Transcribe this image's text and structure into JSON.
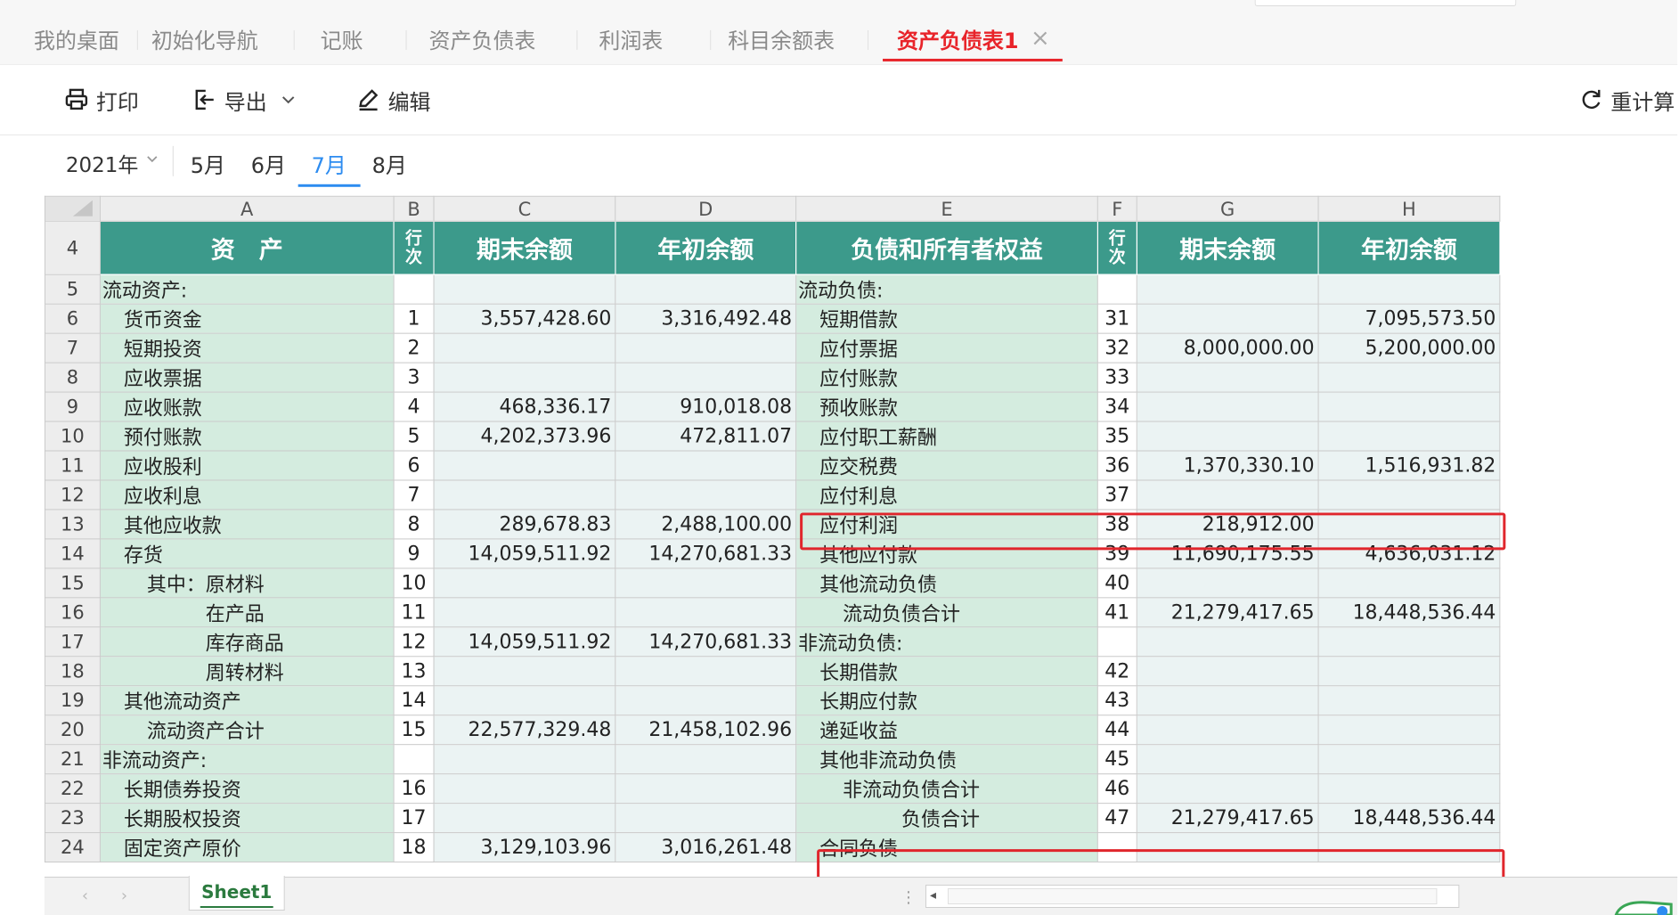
{
  "tabs": [
    {
      "label": "我的桌面"
    },
    {
      "label": "初始化导航"
    },
    {
      "label": "记账"
    },
    {
      "label": "资产负债表"
    },
    {
      "label": "利润表"
    },
    {
      "label": "科目余额表"
    },
    {
      "label": "资产负债表1",
      "active": true
    }
  ],
  "toolbar": {
    "print_label": "打印",
    "export_label": "导出",
    "edit_label": "编辑",
    "recalc_label": "重计算"
  },
  "period": {
    "year": "2021年",
    "months": [
      "5月",
      "6月",
      "7月",
      "8月"
    ],
    "active_month": "7月"
  },
  "grid": {
    "col_letters": [
      "A",
      "B",
      "C",
      "D",
      "E",
      "F",
      "G",
      "H"
    ],
    "header_row_num": "4",
    "headers": {
      "assets": "资　产",
      "line_a": "行次",
      "end_a": "期末余额",
      "begin_a": "年初余额",
      "liab": "负债和所有者权益",
      "line_b": "行次",
      "end_b": "期末余额",
      "begin_b": "年初余额"
    },
    "rows": [
      {
        "r": "5",
        "a": "流动资产:",
        "ai": 0,
        "b": "",
        "c": "",
        "d": "",
        "e": "流动负债:",
        "ei": 0,
        "f": "",
        "g": "",
        "h": ""
      },
      {
        "r": "6",
        "a": "货币资金",
        "ai": 1,
        "b": "1",
        "c": "3,557,428.60",
        "d": "3,316,492.48",
        "e": "短期借款",
        "ei": 1,
        "f": "31",
        "g": "",
        "h": "7,095,573.50"
      },
      {
        "r": "7",
        "a": "短期投资",
        "ai": 1,
        "b": "2",
        "c": "",
        "d": "",
        "e": "应付票据",
        "ei": 1,
        "f": "32",
        "g": "8,000,000.00",
        "h": "5,200,000.00"
      },
      {
        "r": "8",
        "a": "应收票据",
        "ai": 1,
        "b": "3",
        "c": "",
        "d": "",
        "e": "应付账款",
        "ei": 1,
        "f": "33",
        "g": "",
        "h": ""
      },
      {
        "r": "9",
        "a": "应收账款",
        "ai": 1,
        "b": "4",
        "c": "468,336.17",
        "d": "910,018.08",
        "e": "预收账款",
        "ei": 1,
        "f": "34",
        "g": "",
        "h": ""
      },
      {
        "r": "10",
        "a": "预付账款",
        "ai": 1,
        "b": "5",
        "c": "4,202,373.96",
        "d": "472,811.07",
        "e": "应付职工薪酬",
        "ei": 1,
        "f": "35",
        "g": "",
        "h": ""
      },
      {
        "r": "11",
        "a": "应收股利",
        "ai": 1,
        "b": "6",
        "c": "",
        "d": "",
        "e": "应交税费",
        "ei": 1,
        "f": "36",
        "g": "1,370,330.10",
        "h": "1,516,931.82"
      },
      {
        "r": "12",
        "a": "应收利息",
        "ai": 1,
        "b": "7",
        "c": "",
        "d": "",
        "e": "应付利息",
        "ei": 1,
        "f": "37",
        "g": "",
        "h": ""
      },
      {
        "r": "13",
        "a": "其他应收款",
        "ai": 1,
        "b": "8",
        "c": "289,678.83",
        "d": "2,488,100.00",
        "e": "应付利润",
        "ei": 1,
        "f": "38",
        "g": "218,912.00",
        "h": ""
      },
      {
        "r": "14",
        "a": "存货",
        "ai": 1,
        "b": "9",
        "c": "14,059,511.92",
        "d": "14,270,681.33",
        "e": "其他应付款",
        "ei": 1,
        "f": "39",
        "g": "11,690,175.55",
        "h": "4,636,031.12"
      },
      {
        "r": "15",
        "a": "其中：原材料",
        "ai": 2,
        "b": "10",
        "c": "",
        "d": "",
        "e": "其他流动负债",
        "ei": 1,
        "f": "40",
        "g": "",
        "h": ""
      },
      {
        "r": "16",
        "a": "在产品",
        "ai": 3,
        "b": "11",
        "c": "",
        "d": "",
        "e": "流动负债合计",
        "ei": 2,
        "f": "41",
        "g": "21,279,417.65",
        "h": "18,448,536.44"
      },
      {
        "r": "17",
        "a": "库存商品",
        "ai": 3,
        "b": "12",
        "c": "14,059,511.92",
        "d": "14,270,681.33",
        "e": "非流动负债:",
        "ei": 0,
        "f": "",
        "g": "",
        "h": ""
      },
      {
        "r": "18",
        "a": "周转材料",
        "ai": 3,
        "b": "13",
        "c": "",
        "d": "",
        "e": "长期借款",
        "ei": 1,
        "f": "42",
        "g": "",
        "h": ""
      },
      {
        "r": "19",
        "a": "其他流动资产",
        "ai": 1,
        "b": "14",
        "c": "",
        "d": "",
        "e": "长期应付款",
        "ei": 1,
        "f": "43",
        "g": "",
        "h": ""
      },
      {
        "r": "20",
        "a": "流动资产合计",
        "ai": 2,
        "b": "15",
        "c": "22,577,329.48",
        "d": "21,458,102.96",
        "e": "递延收益",
        "ei": 1,
        "f": "44",
        "g": "",
        "h": ""
      },
      {
        "r": "21",
        "a": "非流动资产:",
        "ai": 0,
        "b": "",
        "c": "",
        "d": "",
        "e": "其他非流动负债",
        "ei": 1,
        "f": "45",
        "g": "",
        "h": ""
      },
      {
        "r": "22",
        "a": "长期债券投资",
        "ai": 1,
        "b": "16",
        "c": "",
        "d": "",
        "e": "非流动负债合计",
        "ei": 2,
        "f": "46",
        "g": "",
        "h": ""
      },
      {
        "r": "23",
        "a": "长期股权投资",
        "ai": 1,
        "b": "17",
        "c": "",
        "d": "",
        "e": "负债合计",
        "ei": 3,
        "f": "47",
        "g": "21,279,417.65",
        "h": "18,448,536.44"
      },
      {
        "r": "24",
        "a": "固定资产原价",
        "ai": 1,
        "b": "18",
        "c": "3,129,103.96",
        "d": "3,016,261.48",
        "e": "合同负债",
        "ei": 1,
        "f": "",
        "g": "",
        "h": ""
      }
    ]
  },
  "sheets": [
    {
      "label": "Sheet1",
      "active": true
    }
  ],
  "colors": {
    "accent_red": "#e8242a",
    "accent_blue": "#2d8cf0",
    "header_teal": "#3c9a8b",
    "label_green": "#d4ecdf",
    "value_fill": "#ebf3f3",
    "highlight_red": "#e0262c"
  }
}
